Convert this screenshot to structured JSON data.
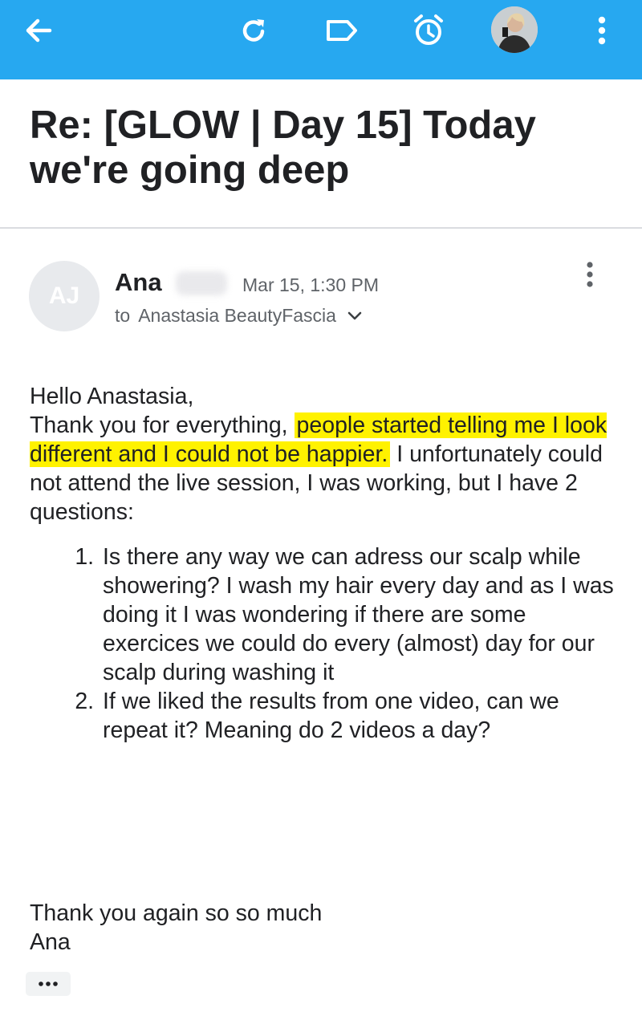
{
  "toolbar": {
    "icons": [
      "back-arrow-icon",
      "refresh-icon",
      "label-icon",
      "snooze-clock-icon",
      "account-avatar",
      "more-vert-icon"
    ],
    "color": "#27a8f0"
  },
  "email": {
    "subject": "Re: [GLOW | Day 15] Today we're going deep",
    "sender": {
      "initials": "AJ",
      "name": "Ana",
      "date": "Mar 15, 1:30 PM",
      "to_prefix": "to",
      "recipient": "Anastasia BeautyFascia"
    },
    "body": {
      "greeting": "Hello Anastasia,",
      "p1_before": "Thank you for everything, ",
      "p1_highlight": "people started telling me I look different and I could not be happier.",
      "p1_after": " I unfortunately could not attend the live session, I was working, but I have 2 questions:",
      "questions": [
        "Is there any way we can adress our scalp while showering? I wash my hair every day and as I was doing it I was wondering if there are some exercices we could do every (almost) day for our scalp during washing it",
        "If we liked the results from one video, can we repeat it? Meaning do 2 videos a day?"
      ],
      "closing_line": "Thank you again so so much",
      "signature": "Ana"
    },
    "highlight_color": "#fff200"
  }
}
